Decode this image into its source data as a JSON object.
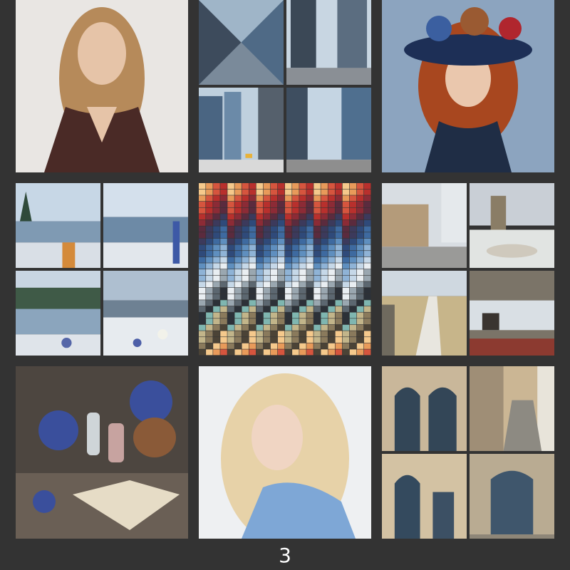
{
  "page": {
    "background": "#333333",
    "number": "3"
  },
  "palette": {
    "swatch_colors": [
      "#f5c98c",
      "#e89a5a",
      "#d6553e",
      "#b8302d",
      "#8c2b36",
      "#5b2b3e",
      "#3c3a5c",
      "#2f4a7a",
      "#3e6aa0",
      "#5f8fbf",
      "#8fb3d6",
      "#c6d8e8",
      "#e9eef2",
      "#9aa7b0",
      "#5c6770",
      "#2c3138",
      "#7fb6b0",
      "#c2b58a",
      "#8a7a5c",
      "#4b4336"
    ]
  }
}
